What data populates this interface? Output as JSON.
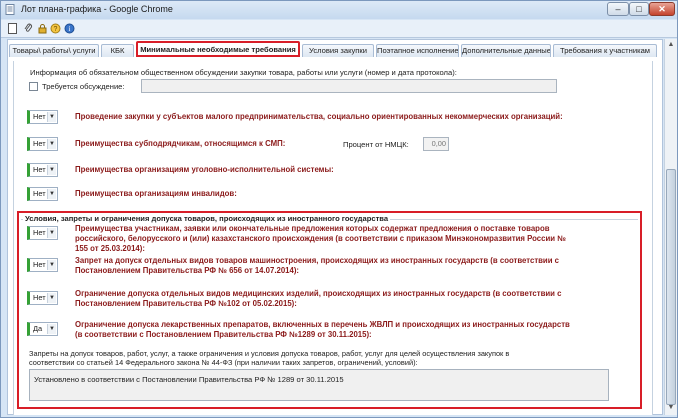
{
  "window": {
    "title": "Лот плана-графика - Google Chrome"
  },
  "tabs": [
    {
      "label": "Товары\\ работы\\ услуги"
    },
    {
      "label": "КБК"
    },
    {
      "label": "Минимальные необходимые требования"
    },
    {
      "label": "Условия закупки"
    },
    {
      "label": "Поэтапное исполнение"
    },
    {
      "label": "Дополнительные данные"
    },
    {
      "label": "Требования к участникам"
    }
  ],
  "discussion": {
    "info_label": "Информация об обязательном общественном обсуждении закупки товара, работы или услуги (номер и дата протокола):",
    "required_label": "Требуется обсуждение:",
    "value": ""
  },
  "requirements": [
    {
      "value": "Нет",
      "text": "Проведение закупки у субъектов малого предпринимательства, социально ориентированных некоммерческих организаций:"
    },
    {
      "value": "Нет",
      "text": "Преимущества субподрядчикам, относящимся к СМП:"
    },
    {
      "value": "Нет",
      "text": "Преимущества организациям уголовно-исполнительной системы:"
    },
    {
      "value": "Нет",
      "text": "Преимущества организациям инвалидов:"
    }
  ],
  "nmck": {
    "label": "Процент от НМЦК:",
    "value": "0,00"
  },
  "foreign": {
    "title": "Условия, запреты и ограничения допуска товаров, происходящих из иностранного государства",
    "rows": [
      {
        "value": "Нет",
        "line1": "Преимущества участникам, заявки или окончательные предложения которых содержат предложения о поставке товаров",
        "line2": "российского, белорусского и (или) казахстанского происхождения (в соответствии с приказом Минэкономразвития России №",
        "line3": "155 от 25.03.2014):"
      },
      {
        "value": "Нет",
        "line1": "Запрет на допуск отдельных видов товаров машиностроения, происходящих из иностранных государств (в соответствии с",
        "line2": "Постановлением Правительства РФ № 656 от 14.07.2014):"
      },
      {
        "value": "Нет",
        "line1": "Ограничение допуска отдельных видов медицинских изделий, происходящих из иностранных государств (в соответствии с",
        "line2": "Постановлением Правительства РФ №102 от 05.02.2015):"
      },
      {
        "value": "Да",
        "line1": "Ограничение допуска лекарственных препаратов, включенных в перечень ЖВЛП и происходящих из иностранных государств",
        "line2": "(в соответствии с Постановлением Правительства РФ №1289 от 30.11.2015):"
      }
    ],
    "note_line1": "Запреты на допуск товаров, работ, услуг, а также ограничения и условия допуска товаров, работ, услуг для целей осуществления закупок в",
    "note_line2": "соответствии со статьей 14 Федерального закона № 44-ФЗ (при наличии таких запретов, ограничений, условий):",
    "textarea_value": "Установлено в соответствии с Постановлении Правительства РФ № 1289 от 30.11.2015"
  },
  "colors": {
    "highlight": "#d81e28",
    "requirement_text": "#8b1a1a",
    "yes_no_accent": "#35a135"
  }
}
